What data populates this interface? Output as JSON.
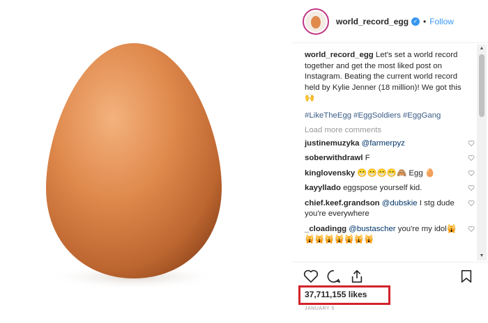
{
  "header": {
    "username": "world_record_egg",
    "follow_label": "Follow",
    "separator": "•"
  },
  "caption": {
    "username": "world_record_egg",
    "text": "Let's set a world record together and get the most liked post on Instagram. Beating the current world record held by Kylie Jenner (18 million)! We got this 🙌"
  },
  "hashtags": [
    "#LikeTheEgg",
    "#EggSoldiers",
    "#EggGang"
  ],
  "load_more": "Load more comments",
  "comments": [
    {
      "user": "justinemuzyka",
      "mention": "@farmerpyz",
      "text": ""
    },
    {
      "user": "soberwithdrawl",
      "mention": "",
      "text": "F"
    },
    {
      "user": "kinglovensky",
      "mention": "",
      "text": "😁😁😁😁🙈 Egg 🥚"
    },
    {
      "user": "kayyllado",
      "mention": "",
      "text": "eggspose yourself kid."
    },
    {
      "user": "chief.keef.grandson",
      "mention": "@dubskie",
      "text": "I stg dude you're everywhere"
    },
    {
      "user": "_cloadingg",
      "mention": "@bustascher",
      "text": "you're my idol🙀🙀🙀🙀🙀🙀🙀🙀"
    }
  ],
  "likes": "37,711,155 likes",
  "date": "JANUARY 5"
}
